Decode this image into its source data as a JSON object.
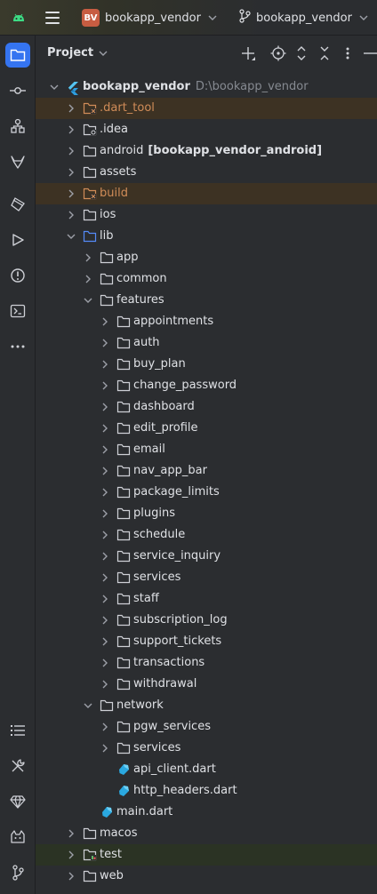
{
  "titlebar": {
    "project_badge": "BV",
    "project_name": "bookapp_vendor",
    "branch_name": "bookapp_vendor"
  },
  "panel": {
    "title": "Project"
  },
  "root": {
    "name": "bookapp_vendor",
    "path": "D:\\bookapp_vendor"
  },
  "tree": [
    {
      "label": ".dart_tool",
      "depth": 1,
      "expanded": false,
      "kind": "excluded"
    },
    {
      "label": ".idea",
      "depth": 1,
      "expanded": false,
      "kind": "config"
    },
    {
      "label": "android",
      "suffix": "[bookapp_vendor_android]",
      "depth": 1,
      "expanded": false,
      "kind": "folder"
    },
    {
      "label": "assets",
      "depth": 1,
      "expanded": false,
      "kind": "folder"
    },
    {
      "label": "build",
      "depth": 1,
      "expanded": false,
      "kind": "excluded"
    },
    {
      "label": "ios",
      "depth": 1,
      "expanded": false,
      "kind": "folder"
    },
    {
      "label": "lib",
      "depth": 1,
      "expanded": true,
      "kind": "source"
    },
    {
      "label": "app",
      "depth": 2,
      "expanded": false,
      "kind": "folder"
    },
    {
      "label": "common",
      "depth": 2,
      "expanded": false,
      "kind": "folder"
    },
    {
      "label": "features",
      "depth": 2,
      "expanded": true,
      "kind": "folder"
    },
    {
      "label": "appointments",
      "depth": 3,
      "expanded": false,
      "kind": "folder"
    },
    {
      "label": "auth",
      "depth": 3,
      "expanded": false,
      "kind": "folder"
    },
    {
      "label": "buy_plan",
      "depth": 3,
      "expanded": false,
      "kind": "folder"
    },
    {
      "label": "change_password",
      "depth": 3,
      "expanded": false,
      "kind": "folder"
    },
    {
      "label": "dashboard",
      "depth": 3,
      "expanded": false,
      "kind": "folder"
    },
    {
      "label": "edit_profile",
      "depth": 3,
      "expanded": false,
      "kind": "folder"
    },
    {
      "label": "email",
      "depth": 3,
      "expanded": false,
      "kind": "folder"
    },
    {
      "label": "nav_app_bar",
      "depth": 3,
      "expanded": false,
      "kind": "folder"
    },
    {
      "label": "package_limits",
      "depth": 3,
      "expanded": false,
      "kind": "folder"
    },
    {
      "label": "plugins",
      "depth": 3,
      "expanded": false,
      "kind": "folder"
    },
    {
      "label": "schedule",
      "depth": 3,
      "expanded": false,
      "kind": "folder"
    },
    {
      "label": "service_inquiry",
      "depth": 3,
      "expanded": false,
      "kind": "folder"
    },
    {
      "label": "services",
      "depth": 3,
      "expanded": false,
      "kind": "folder"
    },
    {
      "label": "staff",
      "depth": 3,
      "expanded": false,
      "kind": "folder"
    },
    {
      "label": "subscription_log",
      "depth": 3,
      "expanded": false,
      "kind": "folder"
    },
    {
      "label": "support_tickets",
      "depth": 3,
      "expanded": false,
      "kind": "folder"
    },
    {
      "label": "transactions",
      "depth": 3,
      "expanded": false,
      "kind": "folder"
    },
    {
      "label": "withdrawal",
      "depth": 3,
      "expanded": false,
      "kind": "folder"
    },
    {
      "label": "network",
      "depth": 2,
      "expanded": true,
      "kind": "folder"
    },
    {
      "label": "pgw_services",
      "depth": 3,
      "expanded": false,
      "kind": "folder"
    },
    {
      "label": "services",
      "depth": 3,
      "expanded": false,
      "kind": "folder"
    },
    {
      "label": "api_client.dart",
      "depth": 3,
      "kind": "dart"
    },
    {
      "label": "http_headers.dart",
      "depth": 3,
      "kind": "dart"
    },
    {
      "label": "main.dart",
      "depth": 2,
      "kind": "dart"
    },
    {
      "label": "macos",
      "depth": 1,
      "expanded": false,
      "kind": "folder"
    },
    {
      "label": "test",
      "depth": 1,
      "expanded": false,
      "kind": "test"
    },
    {
      "label": "web",
      "depth": 1,
      "expanded": false,
      "kind": "folder"
    }
  ],
  "colors": {
    "accent": "#3574f0",
    "excluded_bg": "#3d3223",
    "excluded_text": "#d08c58",
    "test_bg": "#2b3324"
  },
  "icons": {
    "stripe_top": [
      "project-folder-icon",
      "commit-icon",
      "structure-icon",
      "gitlab-icon",
      "bookmarks-icon",
      "run-icon",
      "problems-icon",
      "terminal-icon",
      "more-icon"
    ],
    "stripe_bottom": [
      "todo-icon",
      "build-tools-icon",
      "gem-icon",
      "cat-icon",
      "git-branch-icon"
    ]
  }
}
